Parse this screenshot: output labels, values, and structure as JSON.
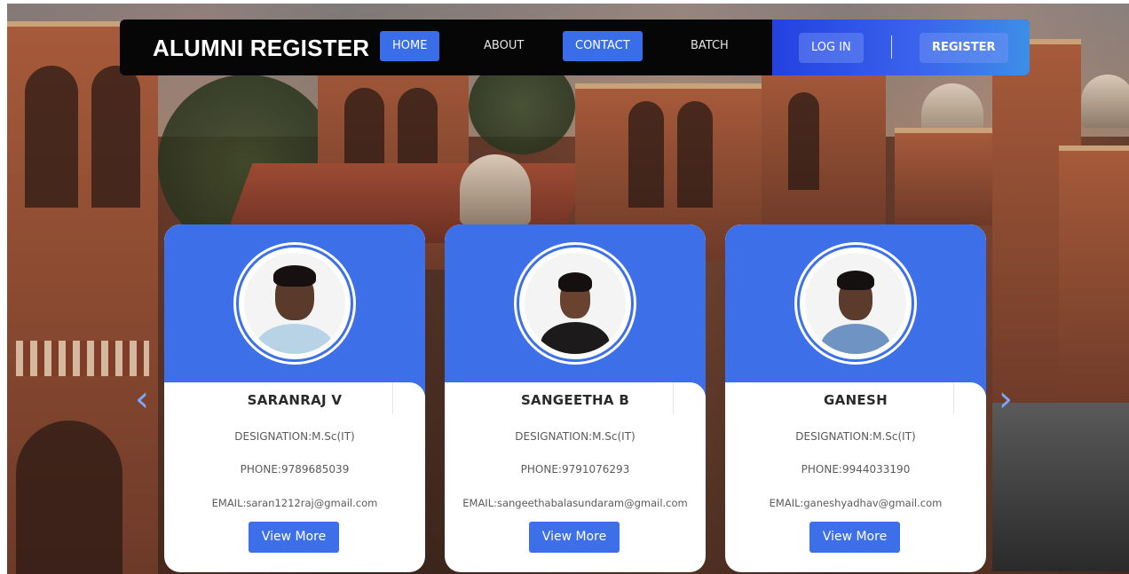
{
  "navbar": {
    "brand": "ALUMNI REGISTER",
    "links": [
      {
        "label": "HOME",
        "active": true
      },
      {
        "label": "ABOUT",
        "active": false
      },
      {
        "label": "CONTACT",
        "active": true
      },
      {
        "label": "BATCH",
        "active": false
      }
    ],
    "login_label": "LOG IN",
    "register_label": "REGISTER"
  },
  "carousel": {
    "prev_icon": "chevron-left-icon",
    "next_icon": "chevron-right-icon",
    "prev_glyph": "‹",
    "next_glyph": "›",
    "cards": [
      {
        "name": "SARANRAJ V",
        "designation": "DESIGNATION:M.Sc(IT)",
        "phone": "PHONE:9789685039",
        "email": "EMAIL:saran1212raj@gmail.com",
        "button_label": "View More"
      },
      {
        "name": "SANGEETHA B",
        "designation": "DESIGNATION:M.Sc(IT)",
        "phone": "PHONE:9791076293",
        "email": "EMAIL:sangeethabalasundaram@gmail.com",
        "button_label": "View More"
      },
      {
        "name": "GANESH",
        "designation": "DESIGNATION:M.Sc(IT)",
        "phone": "PHONE:9944033190",
        "email": "EMAIL:ganeshyadhav@gmail.com",
        "button_label": "View More"
      }
    ]
  },
  "colors": {
    "accent": "#3d6fe8",
    "navbar_bg": "#060606",
    "auth_gradient_start": "#2341e0",
    "auth_gradient_end": "#3d8ee8",
    "chevron": "#7aa7ff"
  }
}
